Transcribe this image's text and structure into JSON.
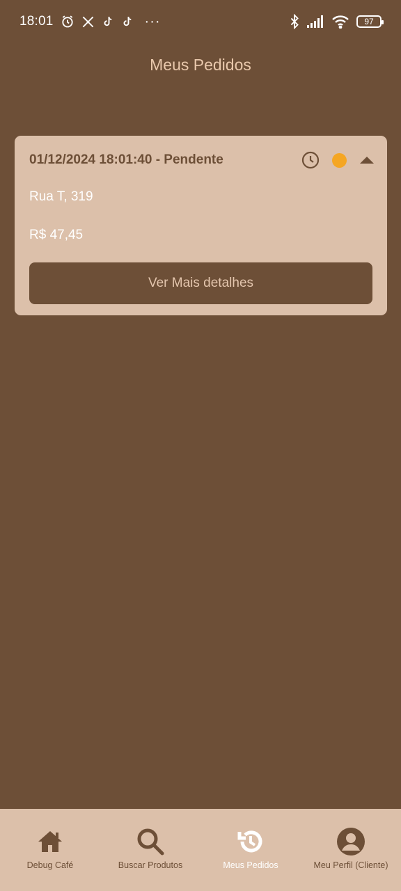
{
  "status_bar": {
    "time": "18:01",
    "more": "···",
    "battery": "97"
  },
  "page": {
    "title": "Meus Pedidos"
  },
  "order": {
    "title": "01/12/2024 18:01:40 - Pendente",
    "address": "Rua T, 319",
    "total": "R$ 47,45",
    "details_label": "Ver Mais detalhes",
    "status_color": "#f5a623"
  },
  "nav": {
    "items": [
      {
        "label": "Debug Café",
        "icon": "home-icon"
      },
      {
        "label": "Buscar Produtos",
        "icon": "search-icon"
      },
      {
        "label": "Meus Pedidos",
        "icon": "history-icon"
      },
      {
        "label": "Meu Perfil (Cliente)",
        "icon": "account-icon"
      }
    ],
    "active_index": 2
  },
  "colors": {
    "background": "#6d4f37",
    "card": "#dcc0aa",
    "accent_text": "#e9c8ac"
  }
}
